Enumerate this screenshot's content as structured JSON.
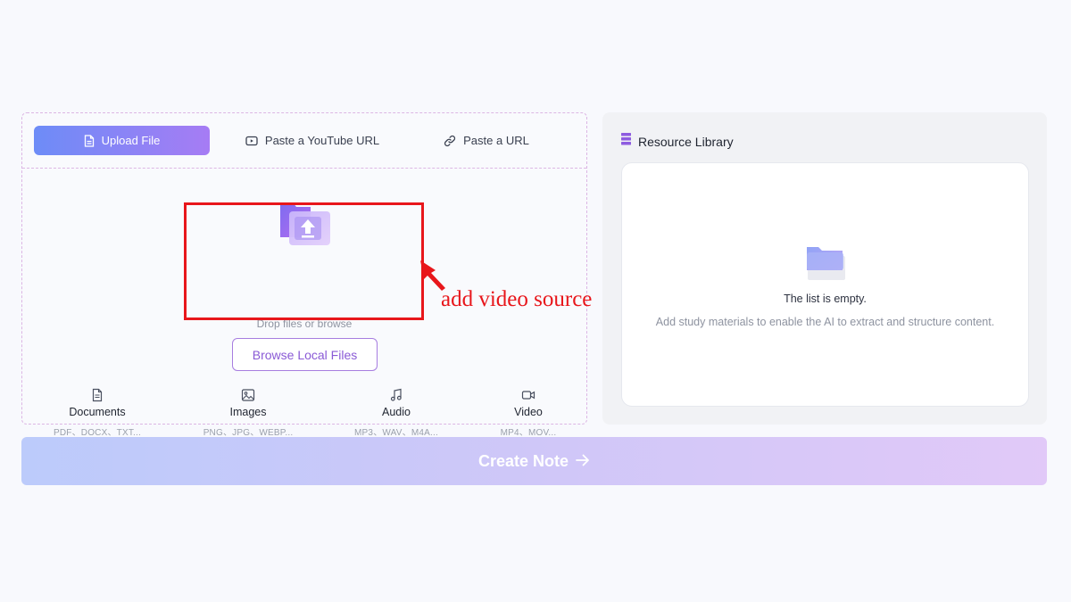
{
  "tabs": [
    {
      "label": "Upload File",
      "icon": "file-icon",
      "active": true
    },
    {
      "label": "Paste a YouTube URL",
      "icon": "youtube-icon",
      "active": false
    },
    {
      "label": "Paste a URL",
      "icon": "link-icon",
      "active": false
    }
  ],
  "upload": {
    "icon": "folder-upload-icon",
    "drop_text": "Drop files or browse",
    "browse_button": "Browse Local Files"
  },
  "file_types": [
    {
      "name": "Documents",
      "ext": "PDF、DOCX、TXT...",
      "icon": "document-icon"
    },
    {
      "name": "Images",
      "ext": "PNG、JPG、WEBP...",
      "icon": "image-icon"
    },
    {
      "name": "Audio",
      "ext": "MP3、WAV、M4A...",
      "icon": "music-icon"
    },
    {
      "name": "Video",
      "ext": "MP4、MOV...",
      "icon": "video-icon"
    }
  ],
  "annotation": {
    "text": "add video source",
    "color": "#e8161b"
  },
  "library": {
    "title": "Resource Library",
    "icon": "library-icon",
    "empty_title": "The list is empty.",
    "empty_subtitle": "Add study materials to enable the AI to extract and structure content."
  },
  "create_button": {
    "label": "Create Note",
    "icon": "arrow-right-icon"
  },
  "colors": {
    "accent_start": "#6d8cf7",
    "accent_end": "#a67cf4",
    "annotation": "#e8161b",
    "page_bg": "#f8f9fd"
  }
}
